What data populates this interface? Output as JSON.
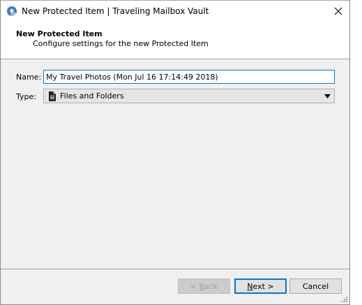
{
  "window": {
    "title": "New Protected Item | Traveling Mailbox Vault"
  },
  "header": {
    "title": "New Protected Item",
    "subtitle": "Configure settings for the new Protected Item"
  },
  "form": {
    "name_label": "Name:",
    "name_value": "My Travel Photos (Mon Jul 16 17:14:49 2018)",
    "type_label": "Type:",
    "type_value": "Files and Folders"
  },
  "buttons": {
    "back_prefix": "< ",
    "back_mnemonic": "B",
    "back_rest": "ack",
    "next_mnemonic": "N",
    "next_rest": "ext >",
    "cancel": "Cancel"
  },
  "colors": {
    "accent": "#0078d7",
    "window_bg": "#f0f0f0"
  },
  "icons": {
    "app": "vault-logo-icon",
    "close": "close-icon",
    "type": "document-icon",
    "dropdown": "chevron-down-icon",
    "grip": "resize-grip-icon"
  }
}
